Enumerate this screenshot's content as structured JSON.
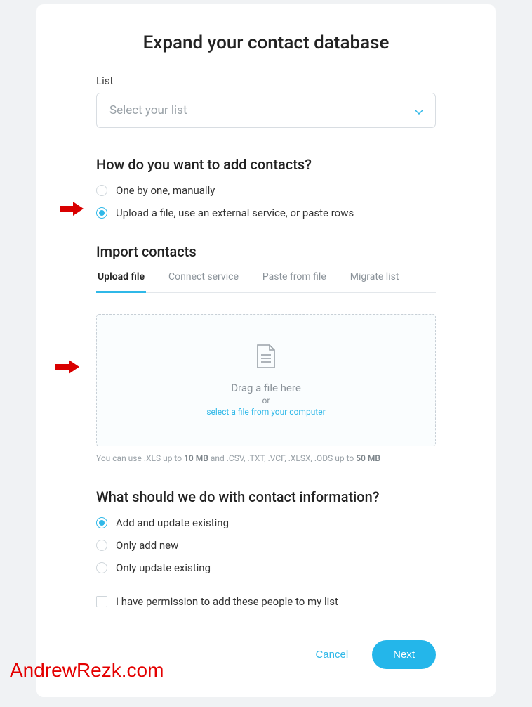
{
  "page": {
    "title": "Expand your contact database"
  },
  "list": {
    "label": "List",
    "placeholder": "Select your list"
  },
  "add_method": {
    "heading": "How do you want to add contacts?",
    "options": {
      "manual": "One by one, manually",
      "upload": "Upload a file, use an external service, or paste rows"
    }
  },
  "import": {
    "heading": "Import contacts",
    "tabs": {
      "upload": "Upload file",
      "connect": "Connect service",
      "paste": "Paste from file",
      "migrate": "Migrate list"
    },
    "dropzone": {
      "drag": "Drag a file here",
      "or": "or",
      "select": "select a file from your computer"
    },
    "hint_prefix": "You can use .XLS up to ",
    "hint_size1": "10 MB",
    "hint_mid": " and .CSV, .TXT, .VCF, .XLSX, .ODS up to ",
    "hint_size2": "50 MB"
  },
  "contact_action": {
    "heading": "What should we do with contact information?",
    "options": {
      "add_update": "Add and update existing",
      "add_new": "Only add new",
      "update": "Only update existing"
    }
  },
  "permission": {
    "label": "I have permission to add these people to my list"
  },
  "buttons": {
    "cancel": "Cancel",
    "next": "Next"
  },
  "watermark": "AndrewRezk.com"
}
